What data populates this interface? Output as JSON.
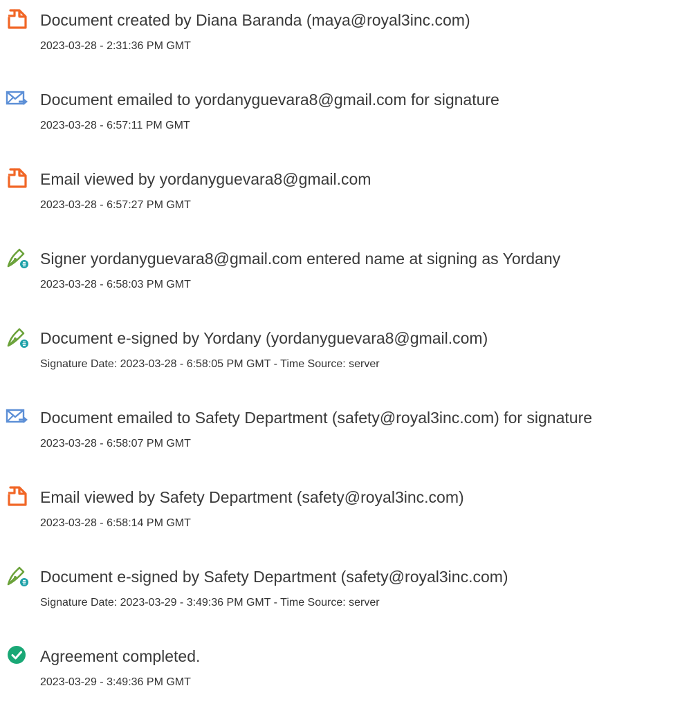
{
  "colors": {
    "document_icon": "#f16626",
    "email_icon": "#5c8fd6",
    "sign_icon_pen": "#6ba23a",
    "sign_icon_badge": "#1da1a8",
    "completed_icon": "#1aa876",
    "title_text": "#3a3a3a",
    "date_text": "#333333"
  },
  "events": [
    {
      "icon": "document-icon",
      "title": "Document created by Diana Baranda (maya@royal3inc.com)",
      "date": "2023-03-28 - 2:31:36 PM GMT"
    },
    {
      "icon": "email-icon",
      "title": "Document emailed to yordanyguevara8@gmail.com for signature",
      "date": "2023-03-28 - 6:57:11 PM GMT"
    },
    {
      "icon": "document-icon",
      "title": "Email viewed by yordanyguevara8@gmail.com",
      "date": "2023-03-28 - 6:57:27 PM GMT"
    },
    {
      "icon": "sign-pen-icon",
      "title": "Signer yordanyguevara8@gmail.com entered name at signing as Yordany",
      "date": "2023-03-28 - 6:58:03 PM GMT"
    },
    {
      "icon": "sign-pen-icon",
      "title": "Document e-signed by Yordany (yordanyguevara8@gmail.com)",
      "date": "Signature Date: 2023-03-28 - 6:58:05 PM GMT - Time Source: server"
    },
    {
      "icon": "email-icon",
      "title": "Document emailed to Safety Department (safety@royal3inc.com) for signature",
      "date": "2023-03-28 - 6:58:07 PM GMT"
    },
    {
      "icon": "document-icon",
      "title": "Email viewed by Safety Department (safety@royal3inc.com)",
      "date": "2023-03-28 - 6:58:14 PM GMT"
    },
    {
      "icon": "sign-pen-icon",
      "title": "Document e-signed by Safety Department (safety@royal3inc.com)",
      "date": "Signature Date: 2023-03-29 - 3:49:36 PM GMT - Time Source: server"
    },
    {
      "icon": "checkmark-circle-icon",
      "title": "Agreement completed.",
      "date": "2023-03-29 - 3:49:36 PM GMT"
    }
  ]
}
